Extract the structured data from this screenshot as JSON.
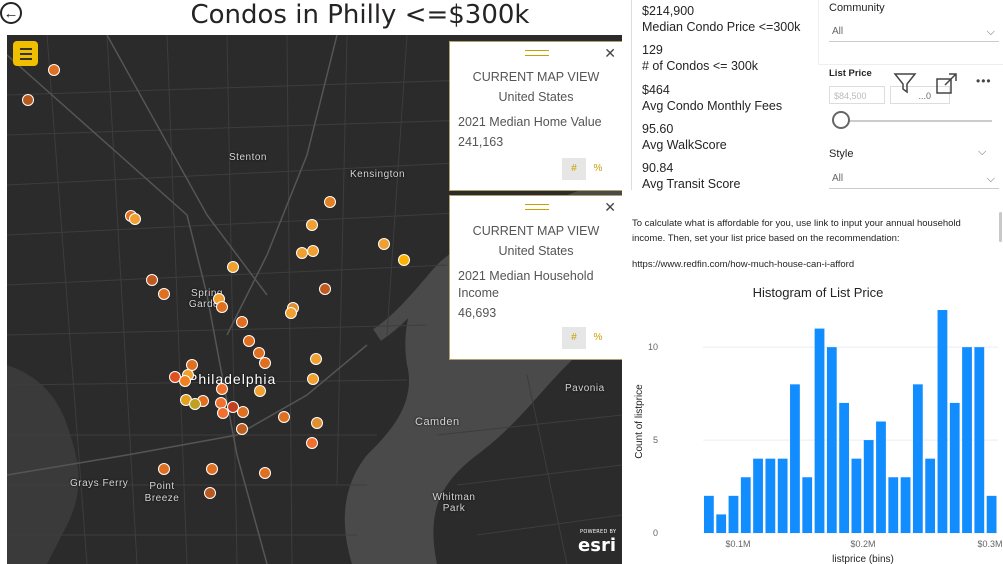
{
  "header": {
    "title": "Condos in Philly <=$300k",
    "back_glyph": "←"
  },
  "map": {
    "labels": {
      "stenton": "Stenton",
      "kensington": "Kensington",
      "spring_garden": "Spring Garden",
      "philadelphia": "Philadelphia",
      "pavonia": "Pavonia",
      "camden": "Camden",
      "grays_ferry": "Grays Ferry",
      "point_breeze": "Point Breeze",
      "whitman_park": "Whitman Park"
    },
    "attribution": {
      "powered_by": "POWERED BY",
      "brand": "esri"
    }
  },
  "cards": [
    {
      "heading": "CURRENT MAP VIEW",
      "location": "United States",
      "metric": "2021 Median Home Value",
      "value": "241,163",
      "btn_count": "#",
      "btn_pct": "%"
    },
    {
      "heading": "CURRENT MAP VIEW",
      "location": "United States",
      "metric": "2021 Median Household Income",
      "value": "46,693",
      "btn_count": "#",
      "btn_pct": "%"
    }
  ],
  "kpis": [
    {
      "value": "$214,900",
      "label": "Median Condo Price <=300k"
    },
    {
      "value": "129",
      "label": "# of Condos <= 300k"
    },
    {
      "value": "$464",
      "label": "Avg Condo Monthly Fees"
    },
    {
      "value": "95.60",
      "label": "Avg WalkScore"
    },
    {
      "value": "90.84",
      "label": "Avg Transit Score"
    }
  ],
  "slicers": {
    "community": {
      "label": "Community",
      "value": "All"
    },
    "list_price": {
      "label": "List Price",
      "min": "$84,500",
      "max": "...0"
    },
    "style": {
      "label": "Style",
      "value": "All"
    }
  },
  "toolbar": {
    "more": "•••"
  },
  "info": {
    "text": "To calculate what is affordable for you, use link to input your annual household income. Then, set your list price based on the recommendation:",
    "url": "https://www.redfin.com/how-much-house-can-i-afford"
  },
  "colors": {
    "bar": "#118dff",
    "accent": "#f0c000",
    "map_bg": "#2b2b2b"
  },
  "chart_data": {
    "type": "bar",
    "title": "Histogram of List Price",
    "xlabel": "listprice (bins)",
    "ylabel": "Count of listprice",
    "ylim": [
      0,
      12
    ],
    "yticks": [
      0,
      5,
      10
    ],
    "xtick_labels": [
      "$0.1M",
      "$0.2M",
      "$0.3M"
    ],
    "values": [
      2,
      1,
      2,
      3,
      4,
      4,
      4,
      8,
      3,
      11,
      10,
      7,
      4,
      5,
      6,
      3,
      3,
      8,
      4,
      12,
      7,
      10,
      10,
      2
    ]
  }
}
